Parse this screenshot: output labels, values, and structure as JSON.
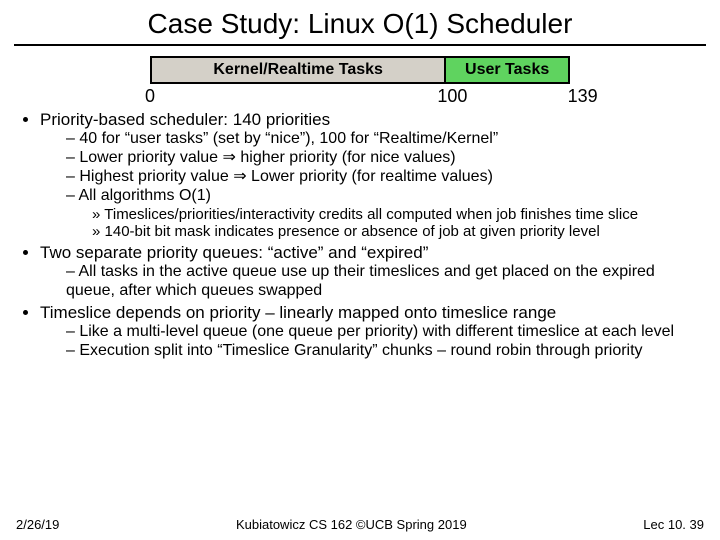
{
  "title": "Case Study: Linux O(1) Scheduler",
  "bar": {
    "kernel": "Kernel/Realtime Tasks",
    "user": "User Tasks",
    "n0": "0",
    "n100": "100",
    "n139": "139"
  },
  "b1": "Priority-based scheduler: 140 priorities",
  "b1a": "40 for “user tasks” (set by “nice”), 100 for “Realtime/Kernel”",
  "b1b_pre": "Lower priority value ",
  "b1b_post": " higher priority (for nice values)",
  "b1c_pre": "Highest priority value ",
  "b1c_post": " Lower priority (for realtime values)",
  "b1d": "All algorithms O(1)",
  "b1d1": "Timeslices/priorities/interactivity credits all computed when job finishes time slice",
  "b1d2": "140-bit bit mask indicates presence or absence of job at given priority level",
  "b2": "Two separate priority queues: “active” and “expired”",
  "b2a": "All tasks in the active queue use up their timeslices and get placed on the expired queue, after which queues swapped",
  "b3": "Timeslice depends on priority – linearly mapped onto timeslice range",
  "b3a": "Like a multi-level queue (one queue per priority) with different timeslice at each level",
  "b3b": "Execution split into “Timeslice Granularity” chunks – round robin through priority",
  "footer": {
    "left": "2/26/19",
    "center": "Kubiatowicz CS 162 ©UCB Spring 2019",
    "right": "Lec 10. 39"
  },
  "glyphs": {
    "implies": "⇒"
  }
}
